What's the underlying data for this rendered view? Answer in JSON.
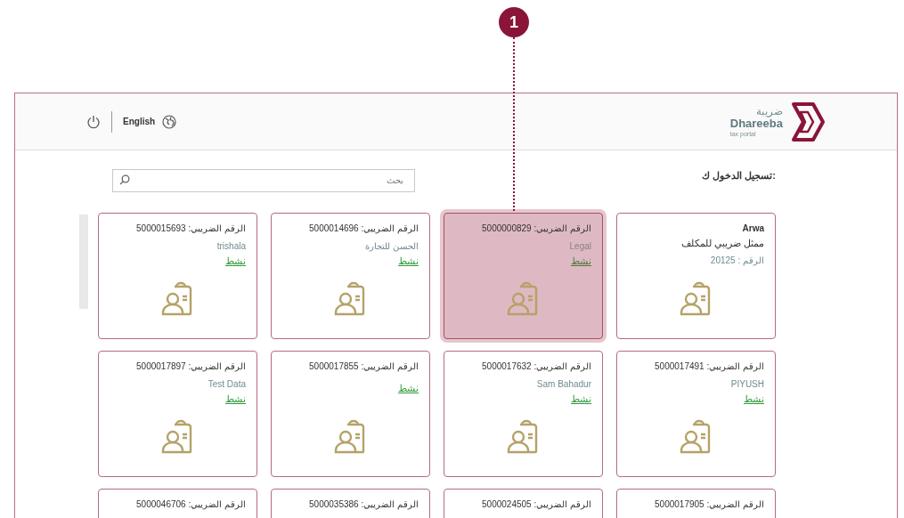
{
  "annotation": {
    "label": "1"
  },
  "header": {
    "language": "English",
    "logo_arabic": "ضريبة",
    "logo_name": "Dhareeba",
    "logo_tagline": "tax portal"
  },
  "login_as": {
    "title": "تسجيل الدخول ك:"
  },
  "search": {
    "placeholder": "بحث"
  },
  "cards": [
    {
      "kind": "representative",
      "name": "Arwa",
      "role": "ممثل ضريبي للمكلف",
      "number": "الرقم : 20125",
      "selected": false
    },
    {
      "kind": "taxpayer",
      "tax_number": "الرقم الضريبي: 5000000829",
      "name": "Legal",
      "status": "نشط",
      "selected": true
    },
    {
      "kind": "taxpayer",
      "tax_number": "الرقم الضريبي: 5000014696",
      "name": "الحسن للتجارة",
      "status": "نشط",
      "selected": false
    },
    {
      "kind": "taxpayer",
      "tax_number": "الرقم الضريبي: 5000015693",
      "name": "trishala",
      "status": "نشط",
      "selected": false
    },
    {
      "kind": "taxpayer",
      "tax_number": "الرقم الضريبي: 5000017491",
      "name": "PIYUSH",
      "status": "نشط",
      "selected": false
    },
    {
      "kind": "taxpayer",
      "tax_number": "الرقم الضريبي: 5000017632",
      "name": "Sam Bahadur",
      "status": "نشط",
      "selected": false
    },
    {
      "kind": "taxpayer",
      "tax_number": "الرقم الضريبي: 5000017855",
      "status": "نشط",
      "selected": false
    },
    {
      "kind": "taxpayer",
      "tax_number": "الرقم الضريبي: 5000017897",
      "name": "Test Data",
      "status": "نشط",
      "selected": false
    },
    {
      "kind": "partial",
      "tax_number": "الرقم الضريبي: 5000017905",
      "selected": false
    },
    {
      "kind": "partial",
      "tax_number": "الرقم الضريبي: 5000024505",
      "selected": false
    },
    {
      "kind": "partial",
      "tax_number": "الرقم الضريبي: 5000035386",
      "selected": false
    },
    {
      "kind": "partial",
      "tax_number": "الرقم الضريبي: 5000046706",
      "selected": false
    }
  ]
}
